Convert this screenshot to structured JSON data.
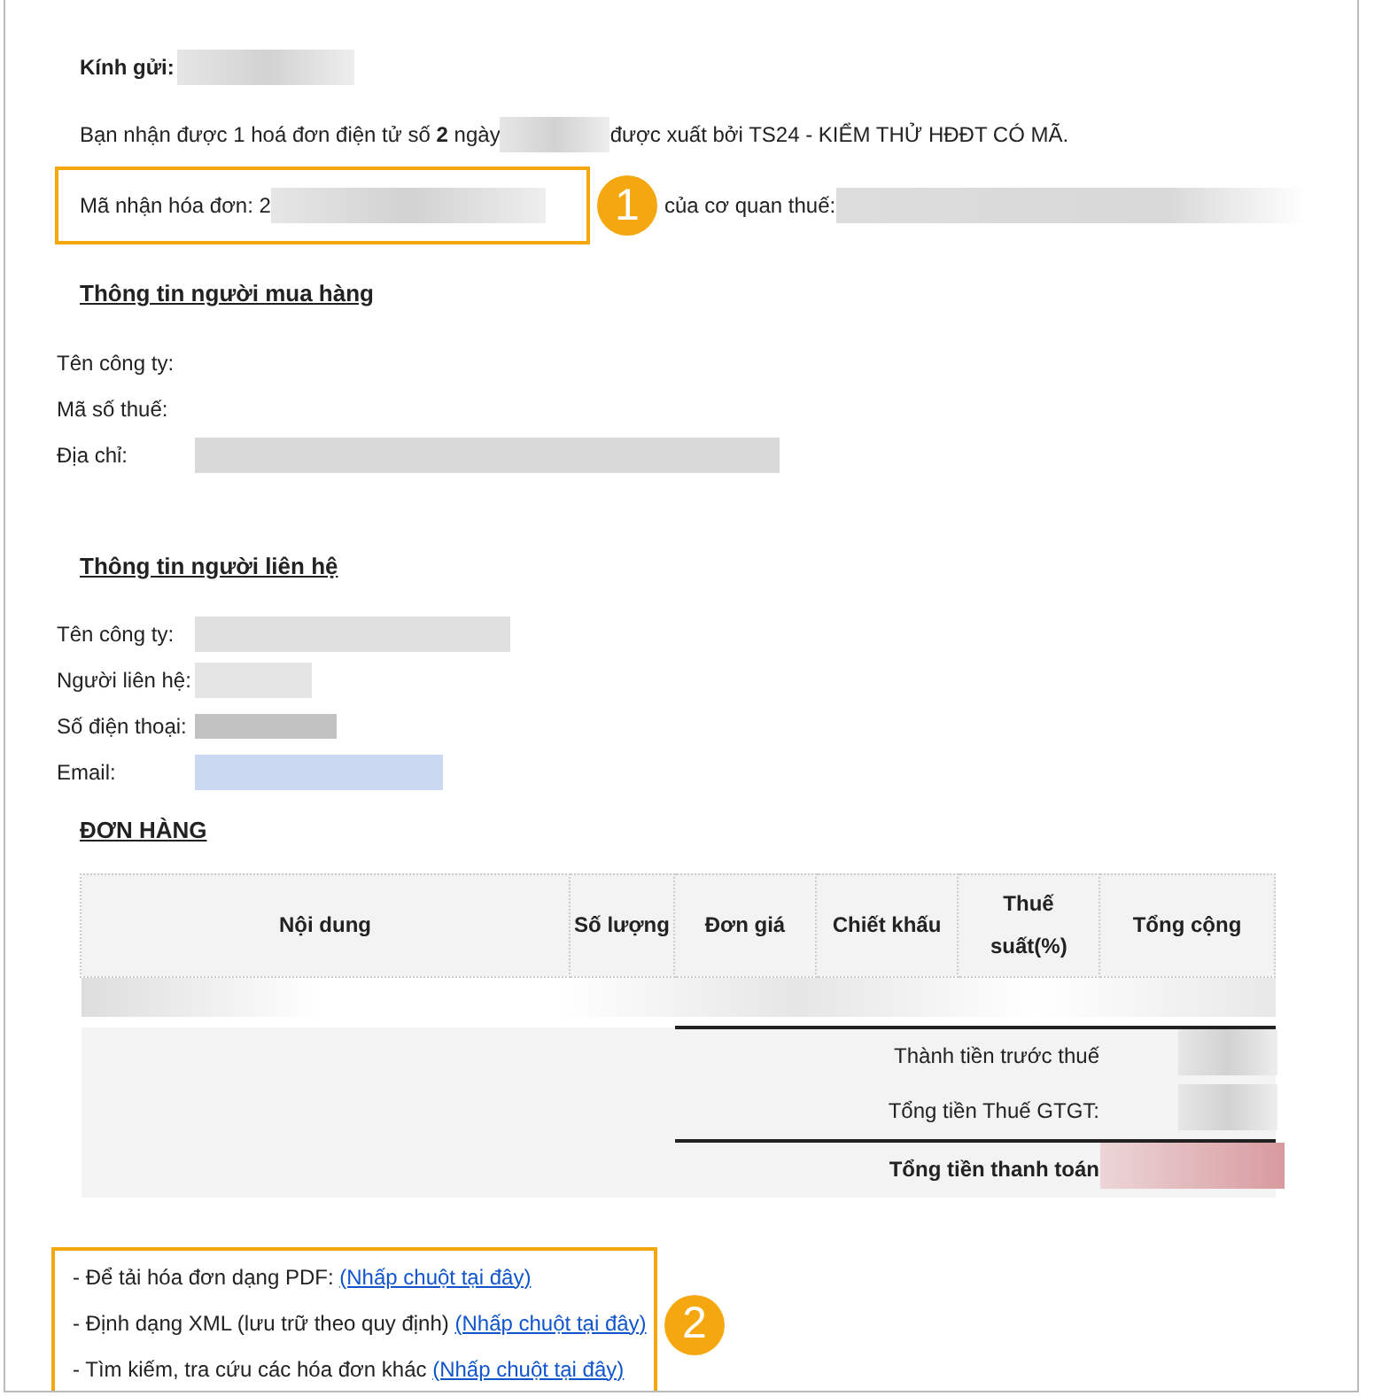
{
  "greeting": {
    "label": "Kính gửi:"
  },
  "intro": {
    "before": "Bạn nhận được 1 hoá đơn điện tử số **2** ngày",
    "after": "được xuất bởi TS24 - KIỂM THỬ HĐĐT CÓ MÃ."
  },
  "code_line": {
    "label": "Mã nhận hóa đơn: 2",
    "callout": "1",
    "suffix": "của cơ quan thuế:"
  },
  "buyer": {
    "title": "Thông tin người mua hàng",
    "fields": [
      {
        "label": "Tên công ty:"
      },
      {
        "label": "Mã số thuế:"
      },
      {
        "label": "Địa chỉ:",
        "color": "#d9d9d9"
      }
    ]
  },
  "contact": {
    "title": "Thông tin người liên hệ",
    "fields": [
      {
        "label": "Tên công ty:",
        "color": "#e0e0e0"
      },
      {
        "label": "Người liên hệ:",
        "color": "#e4e4e4"
      },
      {
        "label": "Số điện thoại:",
        "color": "#c2c2c2"
      },
      {
        "label": "Email:",
        "color": "#cad9f1"
      }
    ]
  },
  "order": {
    "title": "ĐƠN HÀNG",
    "columns": [
      "Nội dung",
      "Số lượng",
      "Đơn giá",
      "Chiết khấu",
      "Thuế suất(%)",
      "Tổng cộng"
    ],
    "totals": [
      {
        "label": "Thành tiền trước thuế",
        "bold": false,
        "rule": true
      },
      {
        "label": "Tổng tiền Thuế GTGT:",
        "bold": false,
        "rule": false
      },
      {
        "label": "Tổng tiền thanh toán",
        "bold": true,
        "rule": true
      }
    ]
  },
  "links": {
    "callout": "2",
    "items": [
      {
        "text": "- Để tải hóa đơn dạng PDF:",
        "link": "(Nhấp chuột tại đây)"
      },
      {
        "text": "- Định dạng XML (lưu trữ theo quy định)",
        "link": "(Nhấp chuột tại đây)"
      },
      {
        "text": "- Tìm kiếm, tra cứu các hóa đơn khác",
        "link": "(Nhấp chuột tại đây)"
      }
    ]
  }
}
